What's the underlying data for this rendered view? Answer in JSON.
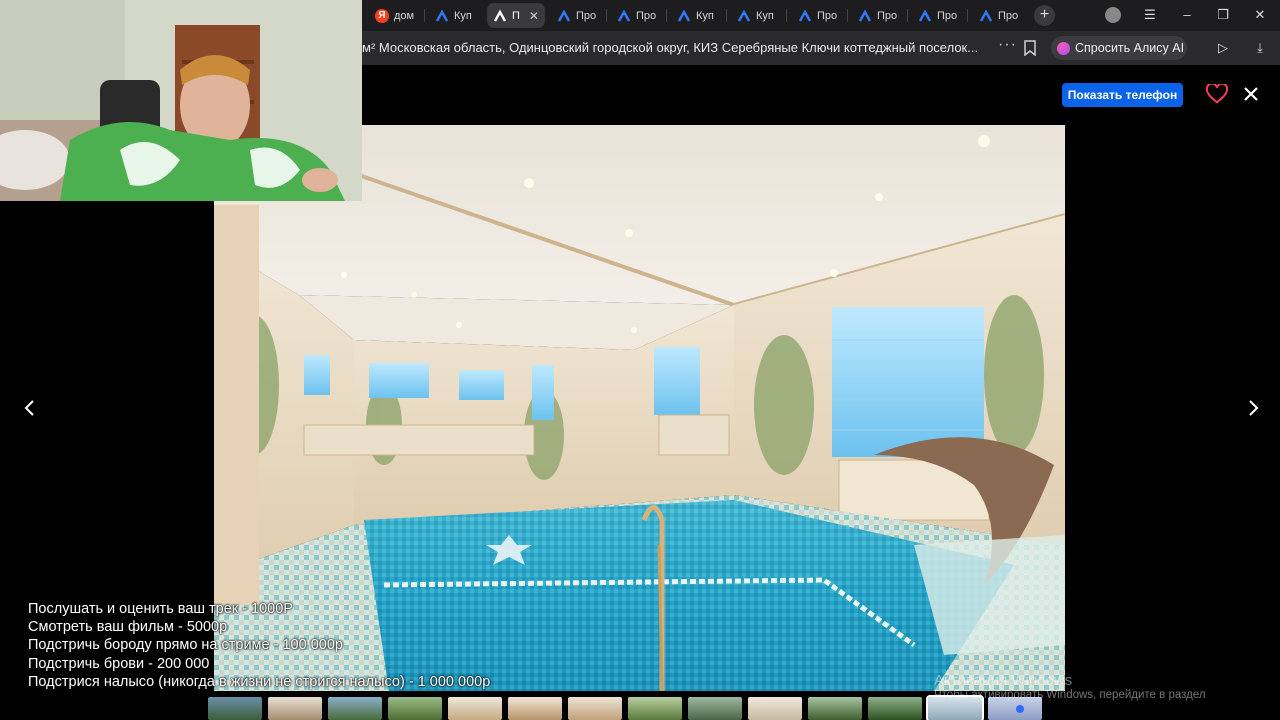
{
  "browser": {
    "tabs": [
      {
        "label": "дом",
        "icon": "yandex-icon",
        "active": false
      },
      {
        "label": "Куп",
        "icon": "avito-icon",
        "active": false
      },
      {
        "label": "П",
        "icon": "avito-icon",
        "active": true
      },
      {
        "label": "Про",
        "icon": "avito-icon",
        "active": false
      },
      {
        "label": "Про",
        "icon": "avito-icon",
        "active": false
      },
      {
        "label": "Куп",
        "icon": "avito-icon",
        "active": false
      },
      {
        "label": "Куп",
        "icon": "avito-icon",
        "active": false
      },
      {
        "label": "Про",
        "icon": "avito-icon",
        "active": false
      },
      {
        "label": "Про",
        "icon": "avito-icon",
        "active": false
      },
      {
        "label": "Про",
        "icon": "avito-icon",
        "active": false
      },
      {
        "label": "Про",
        "icon": "avito-icon",
        "active": false
      }
    ],
    "url_text": "м² Московская область, Одинцовский городской округ, КИЗ Серебряные Ключи коттеджный поселок...",
    "alice_label": "Спросить Алису AI",
    "accent_color": "#0a63e8"
  },
  "viewer": {
    "show_phone_label": "Показать телефон",
    "favorite_icon": "heart-icon",
    "close_icon": "close-icon",
    "prev_icon": "chevron-left-icon",
    "next_icon": "chevron-right-icon",
    "photo_subject": "indoor-pool-photo",
    "thumbnail_count": 14,
    "selected_thumbnail": 13
  },
  "overlay": {
    "donations": [
      "Послушать и оценить ваш трек - 1000Р",
      "Смотреть ваш фильм - 5000р",
      "Подстричь бороду прямо на стриме - 100 000р",
      "Подстричь брови - 200 000",
      "Подстрися налысо (никогда в жизни не стригся налысо) - 1 000 000р"
    ]
  },
  "watermark": {
    "title": "Активация Windows",
    "subtitle": "Чтобы активировать Windows, перейдите в раздел"
  }
}
